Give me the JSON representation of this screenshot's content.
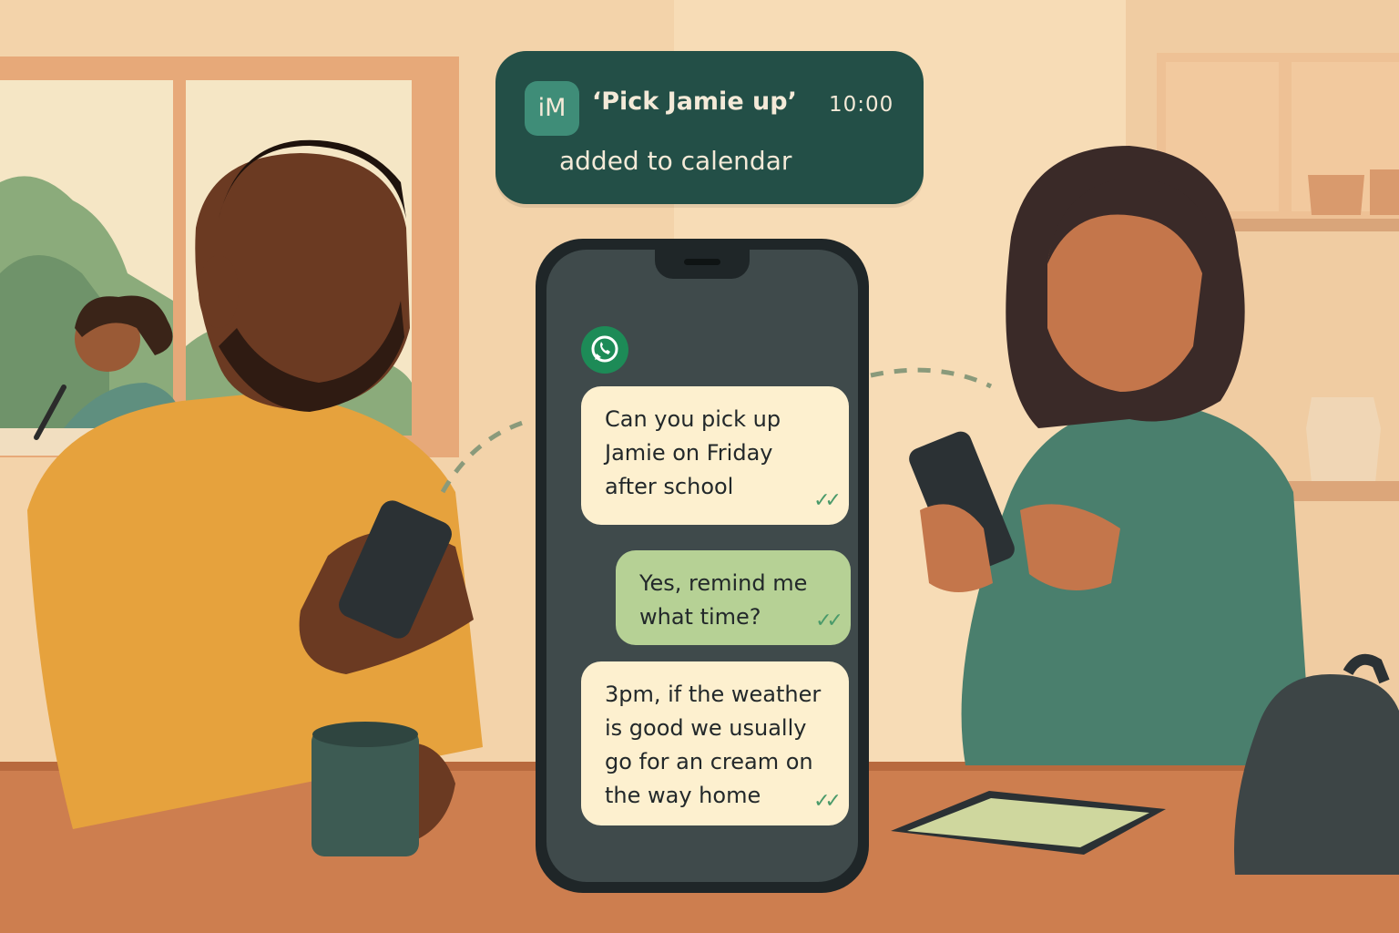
{
  "notification": {
    "app_badge": "iM",
    "title": "‘Pick Jamie up’",
    "time": "10:00",
    "subtitle": "added to calendar"
  },
  "chat": {
    "app_icon": "whatsapp-icon",
    "messages": [
      {
        "direction": "incoming",
        "text": "Can you pick up Jamie on Friday after school",
        "status": "read"
      },
      {
        "direction": "outgoing",
        "text": "Yes, remind me what time?",
        "status": "read"
      },
      {
        "direction": "incoming",
        "text": "3pm, if the weather is good we usually go for an cream on the way home",
        "status": "read"
      }
    ]
  },
  "colors": {
    "notification_bg": "#234f47",
    "incoming_bubble": "#fdf0cf",
    "outgoing_bubble": "#b6d195",
    "phone_frame": "#1f2628",
    "read_ticks": "#4a9a6a"
  }
}
